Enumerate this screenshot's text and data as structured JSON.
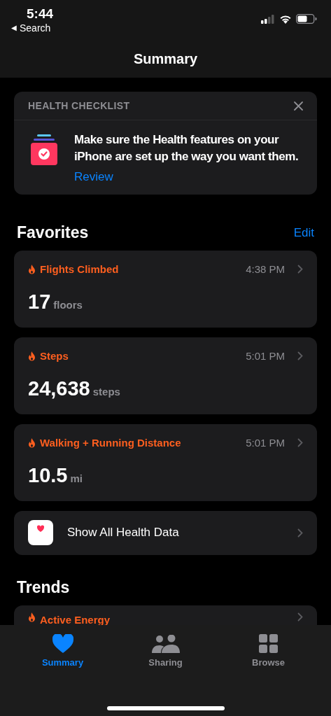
{
  "status_bar": {
    "time": "5:44",
    "back_label": "Search",
    "back_arrow": "◀"
  },
  "nav": {
    "title": "Summary"
  },
  "checklist": {
    "heading": "HEALTH CHECKLIST",
    "message": "Make sure the Health features on your iPhone are set up the way you want them.",
    "link": "Review"
  },
  "favorites": {
    "heading": "Favorites",
    "action": "Edit",
    "items": [
      {
        "title": "Flights Climbed",
        "time": "4:38 PM",
        "value": "17",
        "unit": "floors"
      },
      {
        "title": "Steps",
        "time": "5:01 PM",
        "value": "24,638",
        "unit": "steps"
      },
      {
        "title": "Walking + Running Distance",
        "time": "5:01 PM",
        "value": "10.5",
        "unit": "mi"
      }
    ],
    "show_all": "Show All Health Data"
  },
  "trends": {
    "heading": "Trends",
    "items": [
      {
        "title": "Active Energy"
      }
    ]
  },
  "tab_bar": [
    {
      "kind": "heart",
      "label": "Summary",
      "selected": true
    },
    {
      "kind": "people",
      "label": "Sharing",
      "selected": false
    },
    {
      "kind": "grid",
      "label": "Browse",
      "selected": false
    }
  ]
}
